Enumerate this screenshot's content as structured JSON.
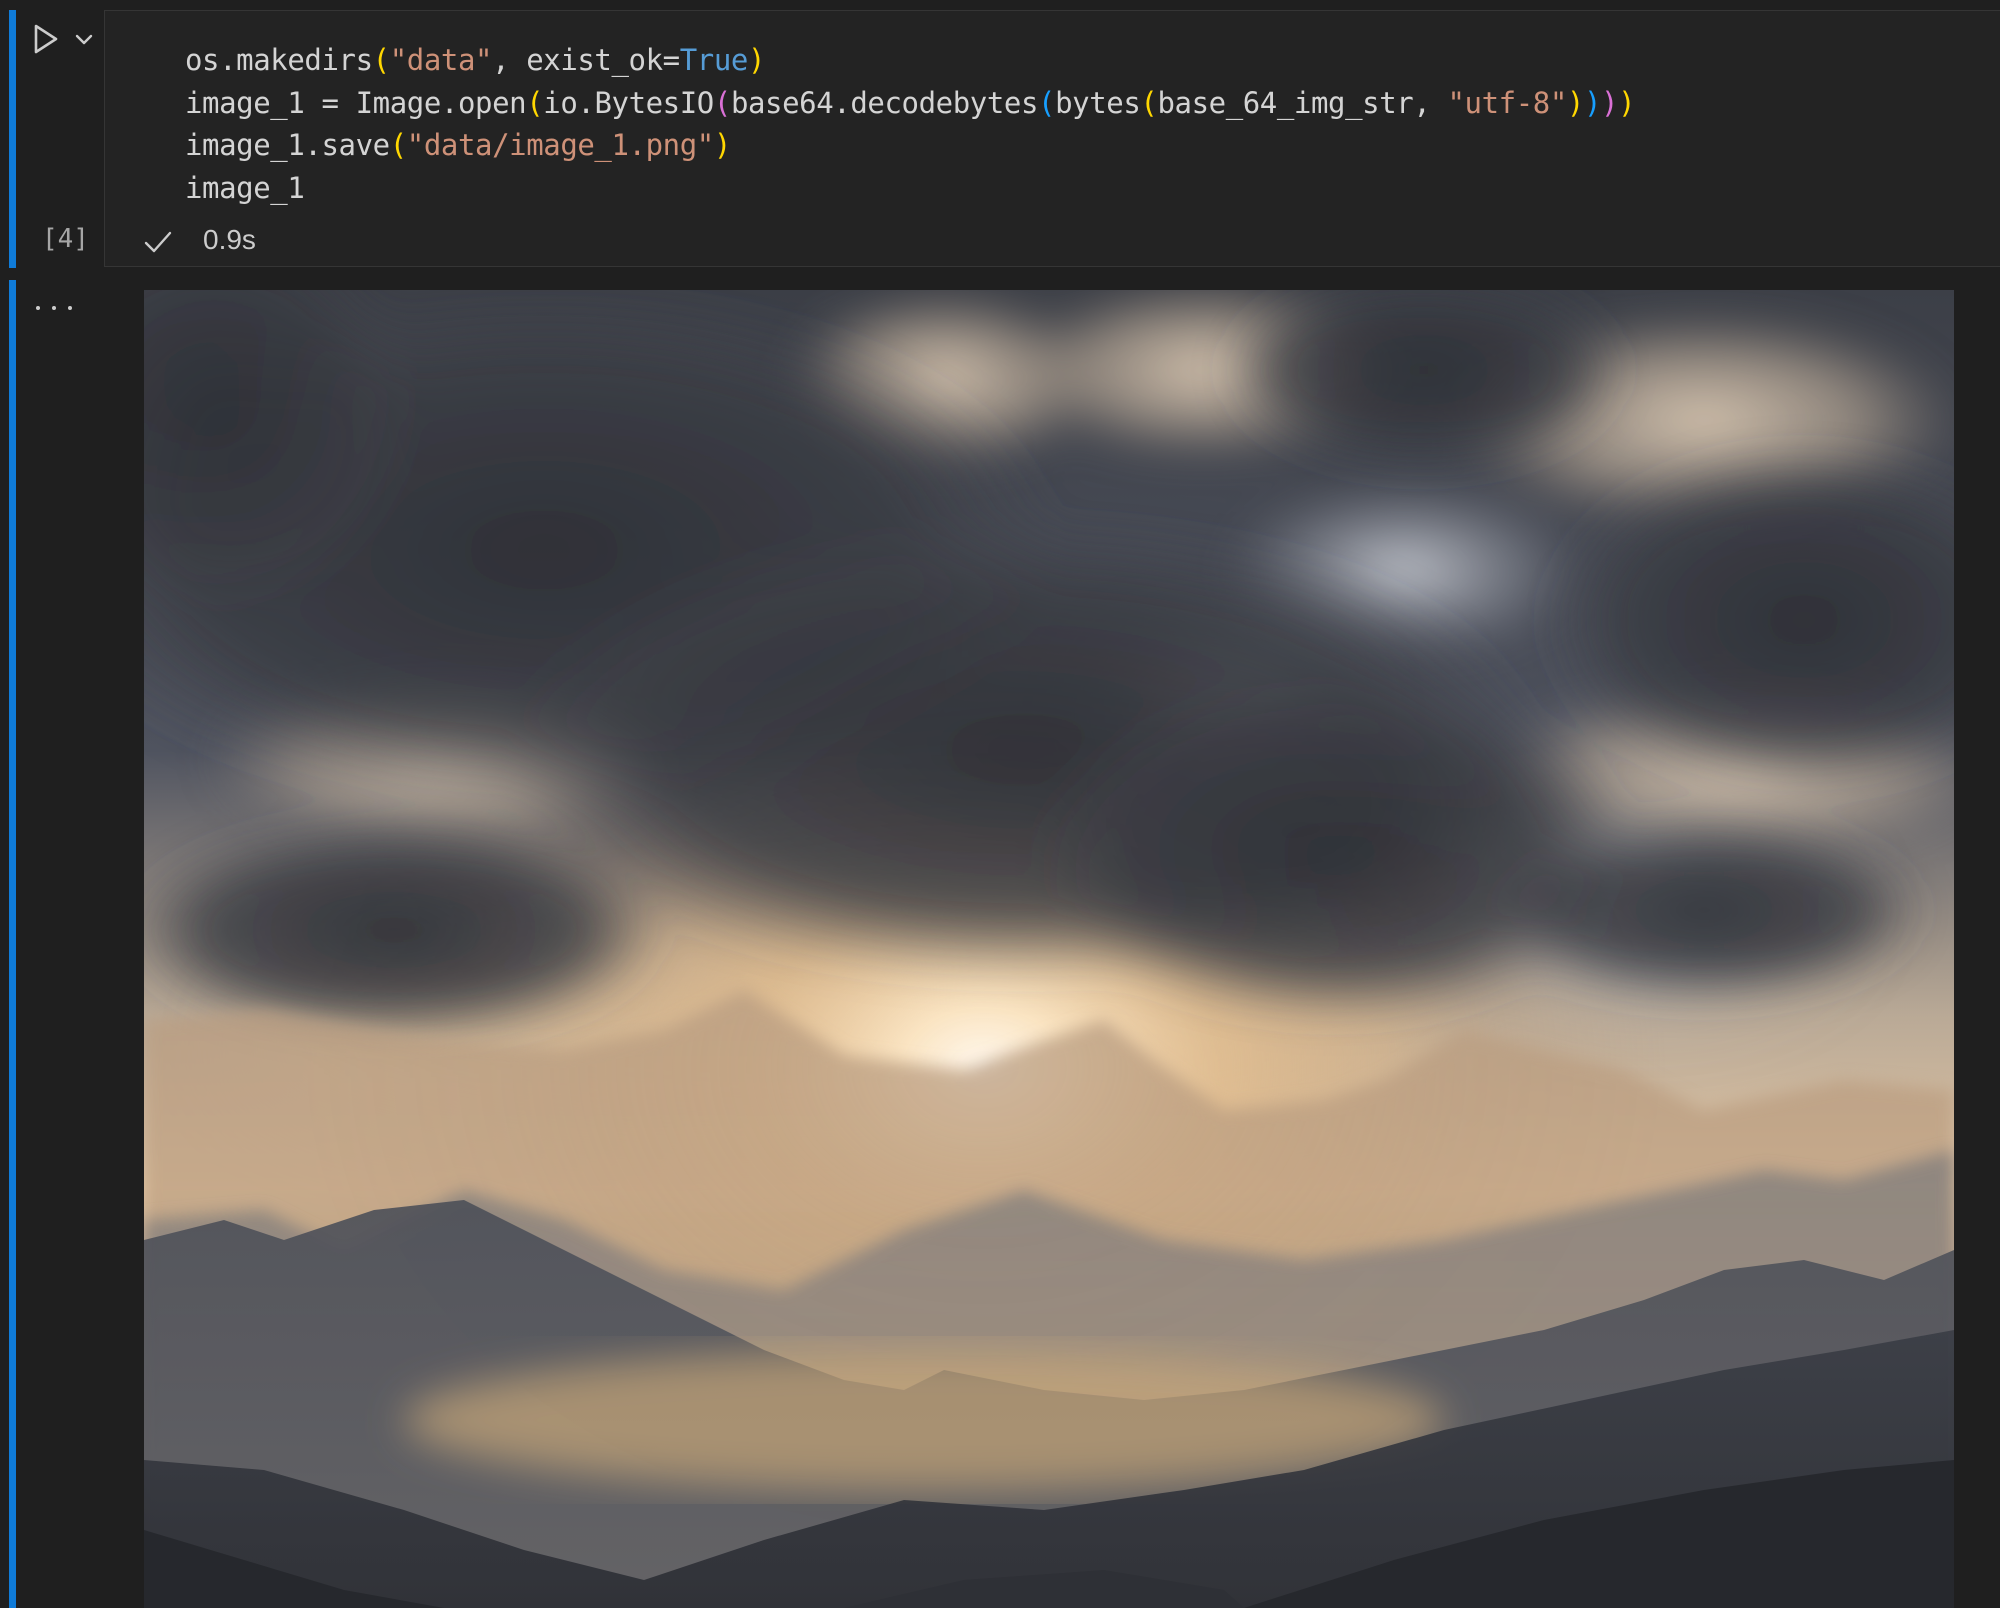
{
  "cell": {
    "execution_count": "[4]",
    "duration": "0.9s",
    "status": "success",
    "code_lines": [
      [
        {
          "t": "os.makedirs",
          "c": "plain"
        },
        {
          "t": "(",
          "c": "p1"
        },
        {
          "t": "\"data\"",
          "c": "str"
        },
        {
          "t": ", exist_ok=",
          "c": "plain"
        },
        {
          "t": "True",
          "c": "kw"
        },
        {
          "t": ")",
          "c": "p1"
        }
      ],
      [
        {
          "t": "image_1 = Image.open",
          "c": "plain"
        },
        {
          "t": "(",
          "c": "p1"
        },
        {
          "t": "io.BytesIO",
          "c": "plain"
        },
        {
          "t": "(",
          "c": "p2"
        },
        {
          "t": "base64.decodebytes",
          "c": "plain"
        },
        {
          "t": "(",
          "c": "p3"
        },
        {
          "t": "bytes",
          "c": "plain"
        },
        {
          "t": "(",
          "c": "p1"
        },
        {
          "t": "base_64_img_str, ",
          "c": "plain"
        },
        {
          "t": "\"utf-8\"",
          "c": "str"
        },
        {
          "t": ")",
          "c": "p1"
        },
        {
          "t": ")",
          "c": "p3"
        },
        {
          "t": ")",
          "c": "p2"
        },
        {
          "t": ")",
          "c": "p1"
        }
      ],
      [
        {
          "t": "image_1.save",
          "c": "plain"
        },
        {
          "t": "(",
          "c": "p1"
        },
        {
          "t": "\"data/image_1.png\"",
          "c": "str"
        },
        {
          "t": ")",
          "c": "p1"
        }
      ],
      [
        {
          "t": "image_1",
          "c": "plain"
        }
      ]
    ]
  },
  "icons": {
    "run": "play-icon",
    "run_menu": "chevron-down-icon",
    "status": "check-icon",
    "output_menu": "ellipsis-icon"
  },
  "colors": {
    "focus_bar": "#0f7bd8",
    "editor_bg": "#232323",
    "string": "#ce9178",
    "keyword": "#569cd6",
    "bracket_1": "#ffd700",
    "bracket_2": "#da70d6",
    "bracket_3": "#179fff"
  },
  "output": {
    "type": "image",
    "image_description_icon": "landscape-photo"
  }
}
